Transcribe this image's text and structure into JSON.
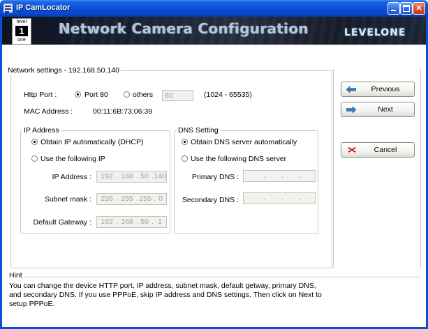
{
  "window": {
    "title": "IP CamLocator"
  },
  "banner": {
    "title": "Network Camera Configuration",
    "brand": "LEVELONE",
    "logo_top": "level",
    "logo_mark": "1",
    "logo_bottom": "one"
  },
  "network": {
    "group_label": "Network settings - 192.168.50.140",
    "http_port_label": "Http Port :",
    "port80_label": "Port 80",
    "others_label": "others",
    "port_value": "80",
    "port_range": "(1024 - 65535)",
    "port80_selected": true,
    "mac_label": "MAC Address :",
    "mac_value": "00:11:6B:73:06:39"
  },
  "ip_address": {
    "group_label": "IP Address",
    "dhcp_label": "Obtain IP automatically (DHCP)",
    "dhcp_selected": true,
    "manual_label": "Use the following IP",
    "ip_label": "IP Address :",
    "ip_octets": [
      "192",
      "168",
      "50",
      "140"
    ],
    "mask_label": "Subnet mask :",
    "mask_octets": [
      "255",
      "255",
      "255",
      "0"
    ],
    "gateway_label": "Default Gateway :",
    "gateway_octets": [
      "192",
      "168",
      "50",
      "1"
    ]
  },
  "dns": {
    "group_label": "DNS Setting",
    "auto_label": "Obtain DNS server automatically",
    "auto_selected": true,
    "manual_label": "Use the following DNS server",
    "primary_label": "Primary DNS :",
    "secondary_label": "Secondary DNS :"
  },
  "buttons": {
    "previous": "Previous",
    "next": "Next",
    "cancel": "Cancel"
  },
  "hint": {
    "label": "Hint",
    "text": "You can change the device HTTP port, IP address, subnet mask, default getway, primary DNS, and secondary DNS. If you use PPPoE, skip IP address and DNS settings. Then click on Next to setup PPPoE."
  },
  "colors": {
    "titlebar": "#0a4fd6",
    "banner_bg": "#1a2233",
    "field_bg": "#f2f2ec",
    "previous_icon": "#3a7ac8",
    "next_icon": "#3a7ac8",
    "cancel_icon": "#d01818"
  }
}
